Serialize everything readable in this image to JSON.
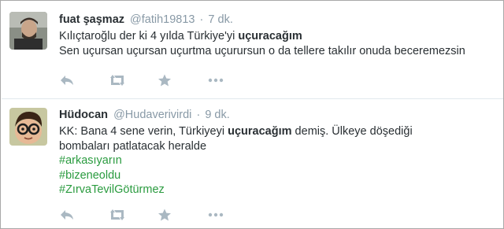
{
  "tweets": [
    {
      "fullname": "fuat şaşmaz",
      "username": "@fatih19813",
      "separator": "·",
      "time": "7 dk.",
      "lines": [
        [
          "Kılıçtaroğlu der ki 4 yılda Türkiye'yi ",
          "uçuracağım",
          ""
        ],
        [
          "Sen uçursan uçursan uçurtma uçurursun o da tellere takılır onuda beceremezsin",
          "",
          ""
        ]
      ],
      "hashtags": []
    },
    {
      "fullname": "Hüdocan",
      "username": "@Hudaverivirdi",
      "separator": "·",
      "time": "9 dk.",
      "lines": [
        [
          "KK: Bana 4 sene verin, Türkiyeyi ",
          "uçuracağım",
          " demiş. Ülkeye döşediği"
        ],
        [
          "bombaları patlatacak heralde",
          "",
          ""
        ]
      ],
      "hashtags": [
        "#arkasıyarın",
        "#bizeneoldu",
        "#ZırvaTevilGötürmez"
      ]
    }
  ],
  "colors": {
    "hashtag": "#2a9b3f",
    "meta": "#8899a6",
    "icon": "#aab8c2",
    "text": "#292f33"
  },
  "icons": [
    "reply-icon",
    "retweet-icon",
    "favorite-icon",
    "more-icon"
  ]
}
